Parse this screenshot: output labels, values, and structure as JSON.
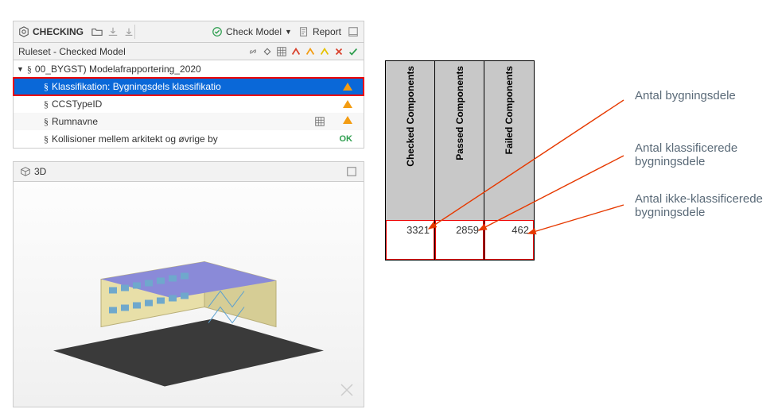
{
  "header": {
    "title": "CHECKING",
    "checkModelLabel": "Check Model",
    "reportLabel": "Report"
  },
  "caption": "Ruleset - Checked Model",
  "tree": {
    "root": {
      "label": "00_BYGST) Modelafrapportering_2020"
    },
    "items": [
      {
        "label": "Klassifikation: Bygningsdels klassifikatio",
        "status": "warn"
      },
      {
        "label": "CCSTypeID",
        "status": "warn"
      },
      {
        "label": "Rumnavne",
        "status": "warn",
        "hasTable": true
      },
      {
        "label": "Kollisioner mellem arkitekt og øvrige by",
        "status": "ok"
      }
    ],
    "okLabel": "OK"
  },
  "viewer": {
    "title": "3D"
  },
  "components": {
    "columns": [
      {
        "header": "Checked Components",
        "value": "3321"
      },
      {
        "header": "Passed Components",
        "value": "2859"
      },
      {
        "header": "Failed Components",
        "value": "462"
      }
    ]
  },
  "annotations": {
    "a1": "Antal bygningsdele",
    "a2_l1": "Antal klassificerede",
    "a2_l2": "bygningsdele",
    "a3_l1": "Antal ikke-klassificerede",
    "a3_l2": "bygningsdele"
  }
}
